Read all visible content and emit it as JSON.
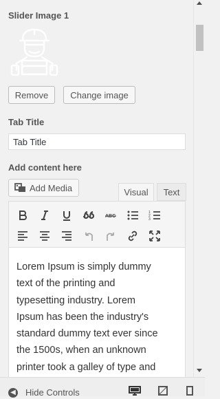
{
  "slider": {
    "label": "Slider Image 1",
    "remove_label": "Remove",
    "change_label": "Change image"
  },
  "tab_title": {
    "label": "Tab Title",
    "value": "Tab Title"
  },
  "content": {
    "label": "Add content here",
    "add_media_label": "Add Media",
    "tabs": [
      {
        "label": "Visual",
        "active": true
      },
      {
        "label": "Text",
        "active": false
      }
    ],
    "toolbar": {
      "row1": [
        "bold-icon",
        "italic-icon",
        "underline-icon",
        "blockquote-icon",
        "strikethrough-icon",
        "bulleted-list-icon",
        "numbered-list-icon"
      ],
      "row2": [
        "align-left-icon",
        "align-center-icon",
        "align-right-icon",
        "undo-icon",
        "redo-icon",
        "link-icon",
        "fullscreen-icon"
      ]
    },
    "body_text": "Lorem Ipsum is simply dummy\ntext of the printing and\ntypesetting industry. Lorem\nIpsum has been the industry's\nstandard dummy text ever since\nthe 1500s, when an unknown\nprinter took a galley of type and"
  },
  "footer": {
    "hide_controls_label": "Hide Controls",
    "devices": [
      "desktop-icon",
      "tablet-icon",
      "mobile-icon"
    ]
  },
  "colors": {
    "panel_bg": "#f1f1f1",
    "editor_bg": "#ffffff",
    "border": "#dddddd",
    "text": "#444444"
  }
}
